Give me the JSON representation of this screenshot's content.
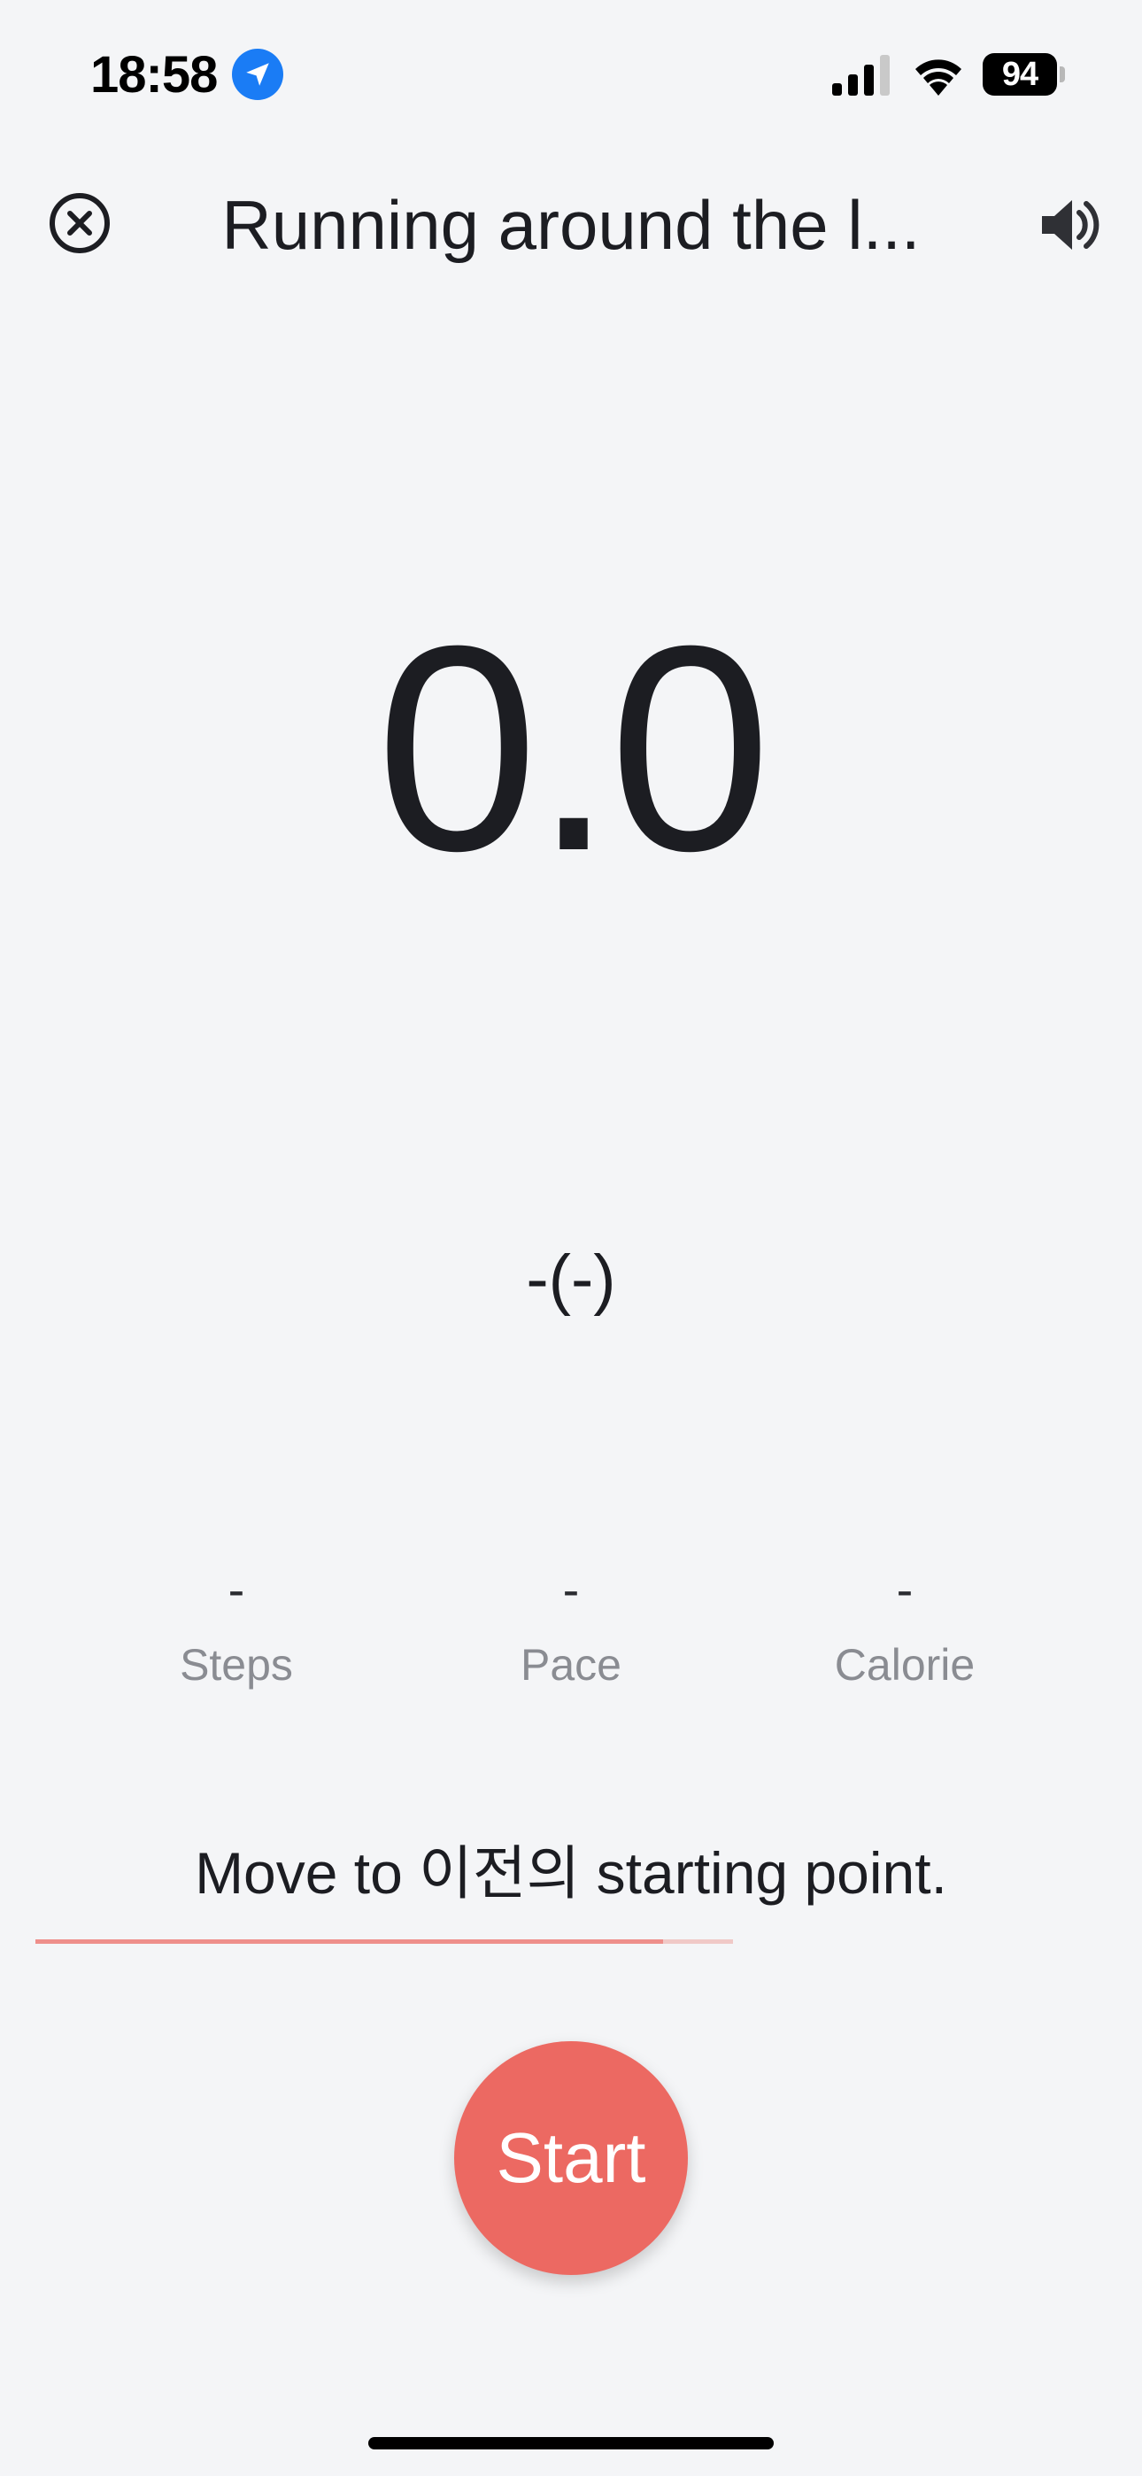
{
  "status_bar": {
    "time": "18:58",
    "battery_level": "94",
    "icons": [
      "location-arrow-icon",
      "cellular-signal-icon",
      "wifi-icon",
      "battery-icon"
    ]
  },
  "header": {
    "title": "Running around the l...",
    "close_icon": "close-circle-icon",
    "sound_icon": "speaker-icon"
  },
  "workout": {
    "distance": "0.0",
    "time": "-(-)"
  },
  "stats": [
    {
      "value": "-",
      "label": "Steps"
    },
    {
      "value": "-",
      "label": "Pace"
    },
    {
      "value": "-",
      "label": "Calorie"
    }
  ],
  "guide": {
    "message": "Move to 이전의  starting point.",
    "progress": 0.9
  },
  "actions": {
    "start_label": "Start"
  },
  "colors": {
    "background": "#f4f5f7",
    "accent": "#ec6962",
    "location_blue": "#1a7cf5",
    "secondary_text": "#8a8c92",
    "progress_bar": "#ee8f8b"
  }
}
